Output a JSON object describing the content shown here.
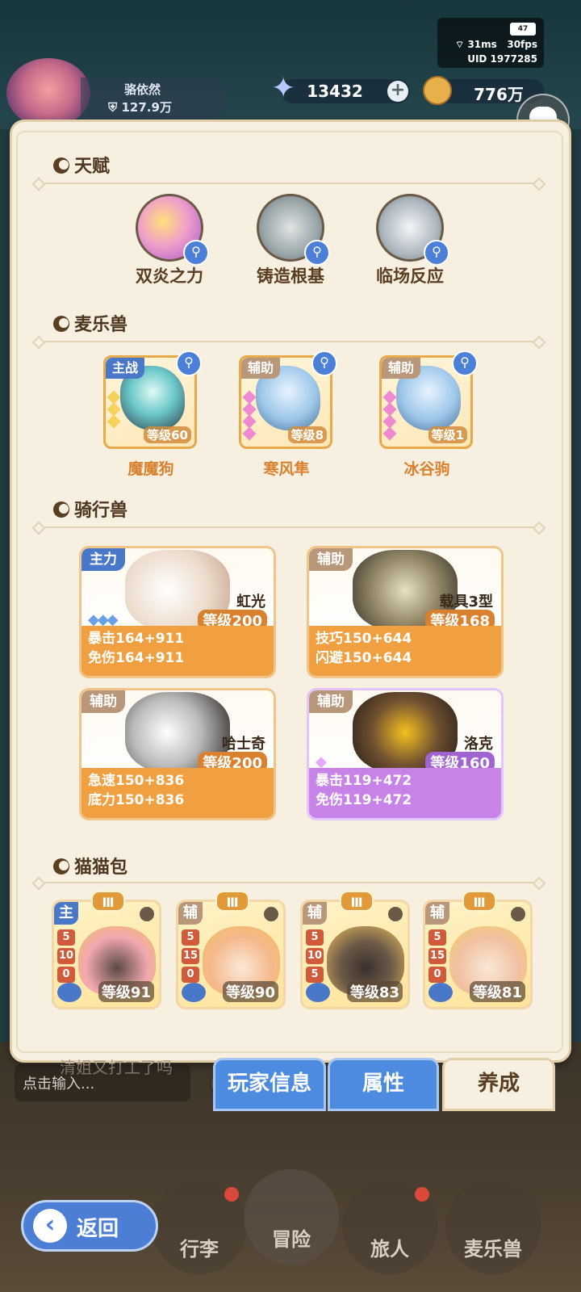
{
  "status": {
    "battery": "47",
    "ping": "31ms",
    "fps": "30fps",
    "uid": "UID  1977285"
  },
  "player": {
    "name": "骆依然",
    "power": "127.9万"
  },
  "currency": {
    "gems": "13432",
    "gold": "776万",
    "plus": "+"
  },
  "sections": {
    "talent": "天赋",
    "pets": "麦乐兽",
    "mounts": "骑行兽",
    "cats": "猫猫包"
  },
  "talents": [
    {
      "name": "双炎之力",
      "icon": "flame-orb-icon"
    },
    {
      "name": "铸造根基",
      "icon": "sword-icon"
    },
    {
      "name": "临场反应",
      "icon": "crystal-icon"
    }
  ],
  "pets": [
    {
      "tag": "主战",
      "name": "魔魔狗",
      "level": "等级60"
    },
    {
      "tag": "辅助",
      "name": "寒风隼",
      "level": "等级8"
    },
    {
      "tag": "辅助",
      "name": "冰谷驹",
      "level": "等级1"
    }
  ],
  "mounts": [
    {
      "tag": "主力",
      "name": "虹光",
      "level": "等级200",
      "stat1": "暴击164+911",
      "stat2": "免伤164+911"
    },
    {
      "tag": "辅助",
      "name": "载具3型",
      "level": "等级168",
      "stat1": "技巧150+644",
      "stat2": "闪避150+644"
    },
    {
      "tag": "辅助",
      "name": "哈士奇",
      "level": "等级200",
      "stat1": "急速150+836",
      "stat2": "底力150+836"
    },
    {
      "tag": "辅助",
      "name": "洛克",
      "level": "等级160",
      "stat1": "暴击119+472",
      "stat2": "免伤119+472"
    }
  ],
  "cats": [
    {
      "tag": "主",
      "rank": "Ⅲ",
      "n1": "5",
      "n2": "10",
      "n3": "0",
      "level": "等级91"
    },
    {
      "tag": "辅",
      "rank": "Ⅲ",
      "n1": "5",
      "n2": "15",
      "n3": "0",
      "level": "等级90"
    },
    {
      "tag": "辅",
      "rank": "Ⅲ",
      "n1": "5",
      "n2": "10",
      "n3": "5",
      "level": "等级83"
    },
    {
      "tag": "辅",
      "rank": "Ⅲ",
      "n1": "5",
      "n2": "15",
      "n3": "0",
      "level": "等级81"
    }
  ],
  "tabs": {
    "player_info": "玩家信息",
    "attributes": "属性",
    "cultivation": "养成"
  },
  "chat": {
    "message": "清姐又打工了吗",
    "placeholder": "点击输入..."
  },
  "nav": {
    "bag": "行李",
    "adventure": "冒险",
    "traveler": "旅人",
    "pets": "麦乐兽",
    "back": "返回"
  },
  "colors": {
    "accent_blue": "#4d8be0",
    "panel": "#f7efe0",
    "orange": "#f0a040",
    "purple": "#c883e8"
  }
}
